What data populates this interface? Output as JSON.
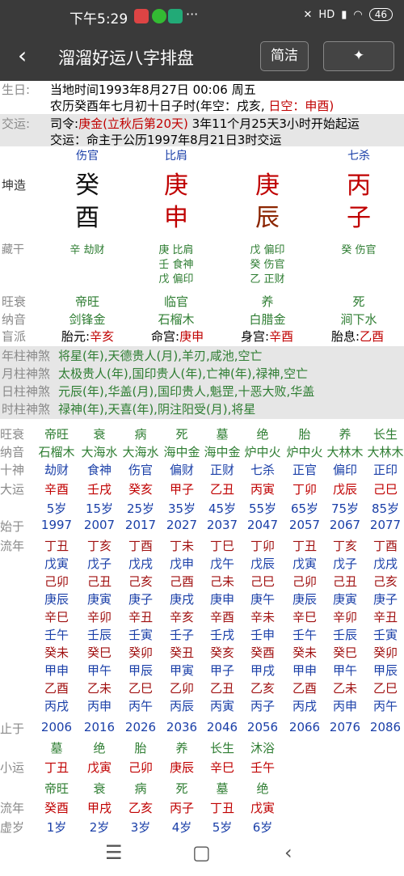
{
  "status": {
    "time": "下午5:29",
    "dots": "···",
    "right": "HD",
    "battery": "46"
  },
  "app": {
    "title": "溜溜好运八字排盘",
    "back": "‹",
    "btn_simple": "简洁",
    "btn_magic": "✦"
  },
  "info": {
    "sheng_label": "生日:",
    "sheng_line1": "当地时间1993年8月27日 00:06 周五",
    "sheng_line2a": "农历癸酉年七月初十日子时(年空：戌亥,",
    "sheng_line2b": " 日空：申酉)",
    "jiao_label": "交运:",
    "siling_a": "司令:",
    "siling_b": "庚金(立秋后第20天)",
    "siling_c": " 3年11个月25天3小时开始起运",
    "jiao_line2": "交运：命主于公历1997年8月21日3时交运"
  },
  "pillars": {
    "label": "坤造",
    "gods": [
      "伤官",
      "比肩",
      "",
      "七杀"
    ],
    "stems": [
      "癸",
      "庚",
      "庚",
      "丙"
    ],
    "branches": [
      "酉",
      "申",
      "辰",
      "子"
    ]
  },
  "canggan": {
    "label": "藏干",
    "cols": [
      [
        "辛 劫财"
      ],
      [
        "庚 比肩",
        "壬 食神",
        "戊 偏印"
      ],
      [
        "戊 偏印",
        "癸 伤官",
        "乙 正财"
      ],
      [
        "癸 伤官"
      ]
    ]
  },
  "wangshuai": {
    "label": "旺衰",
    "vals": [
      "帝旺",
      "临官",
      "养",
      "死"
    ]
  },
  "nayin": {
    "label": "纳音",
    "vals": [
      "剑锋金",
      "石榴木",
      "白腊金",
      "涧下水"
    ]
  },
  "mangpai": {
    "label": "盲派",
    "vals": [
      "胎元:",
      "辛亥",
      "命宫:",
      "庚申",
      "身宫:",
      "辛酉",
      "胎息:",
      "乙酉"
    ]
  },
  "shensha": [
    {
      "label": "年柱神煞",
      "text": "将星(年),天德贵人(月),羊刃,咸池,空亡"
    },
    {
      "label": "月柱神煞",
      "text": "太极贵人(年),国印贵人(年),亡神(年),禄神,空亡"
    },
    {
      "label": "日柱神煞",
      "text": "元辰(年),华盖(月),国印贵人,魁罡,十恶大败,华盖"
    },
    {
      "label": "时柱神煞",
      "text": "禄神(年),天喜(年),阴注阳受(月),将星"
    }
  ],
  "dayun": {
    "ws_label": "旺衰",
    "ws": [
      "帝旺",
      "衰",
      "病",
      "死",
      "墓",
      "绝",
      "胎",
      "养",
      "长生"
    ],
    "ny_label": "纳音",
    "ny": [
      "石榴木",
      "大海水",
      "大海水",
      "海中金",
      "海中金",
      "炉中火",
      "炉中火",
      "大林木",
      "大林木"
    ],
    "ss_label": "十神",
    "ss": [
      "劫财",
      "食神",
      "伤官",
      "偏财",
      "正财",
      "七杀",
      "正官",
      "偏印",
      "正印"
    ],
    "dy_label": "大运",
    "dy": [
      "辛酉",
      "壬戌",
      "癸亥",
      "甲子",
      "乙丑",
      "丙寅",
      "丁卯",
      "戊辰",
      "己巳"
    ],
    "age": [
      "5岁",
      "15岁",
      "25岁",
      "35岁",
      "45岁",
      "55岁",
      "65岁",
      "75岁",
      "85岁"
    ],
    "start_label": "始于",
    "start": [
      "1997",
      "2007",
      "2017",
      "2027",
      "2037",
      "2047",
      "2057",
      "2067",
      "2077"
    ],
    "ln_label": "流年",
    "liunian": [
      [
        "丁丑",
        "丁亥",
        "丁酉",
        "丁未",
        "丁巳",
        "丁卯",
        "丁丑",
        "丁亥",
        "丁酉"
      ],
      [
        "戊寅",
        "戊子",
        "戊戌",
        "戊申",
        "戊午",
        "戊辰",
        "戊寅",
        "戊子",
        "戊戌"
      ],
      [
        "己卯",
        "己丑",
        "己亥",
        "己酉",
        "己未",
        "己巳",
        "己卯",
        "己丑",
        "己亥"
      ],
      [
        "庚辰",
        "庚寅",
        "庚子",
        "庚戌",
        "庚申",
        "庚午",
        "庚辰",
        "庚寅",
        "庚子"
      ],
      [
        "辛巳",
        "辛卯",
        "辛丑",
        "辛亥",
        "辛酉",
        "辛未",
        "辛巳",
        "辛卯",
        "辛丑"
      ],
      [
        "壬午",
        "壬辰",
        "壬寅",
        "壬子",
        "壬戌",
        "壬申",
        "壬午",
        "壬辰",
        "壬寅"
      ],
      [
        "癸未",
        "癸巳",
        "癸卯",
        "癸丑",
        "癸亥",
        "癸酉",
        "癸未",
        "癸巳",
        "癸卯"
      ],
      [
        "甲申",
        "甲午",
        "甲辰",
        "甲寅",
        "甲子",
        "甲戌",
        "甲申",
        "甲午",
        "甲辰"
      ],
      [
        "乙酉",
        "乙未",
        "乙巳",
        "乙卯",
        "乙丑",
        "乙亥",
        "乙酉",
        "乙未",
        "乙巳"
      ],
      [
        "丙戌",
        "丙申",
        "丙午",
        "丙辰",
        "丙寅",
        "丙子",
        "丙戌",
        "丙申",
        "丙午"
      ]
    ],
    "end_label": "止于",
    "end": [
      "2006",
      "2016",
      "2026",
      "2036",
      "2046",
      "2056",
      "2066",
      "2076",
      "2086"
    ]
  },
  "xiaoyun": {
    "ws": [
      "墓",
      "绝",
      "胎",
      "养",
      "长生",
      "沐浴"
    ],
    "label": "小运",
    "vals": [
      "丁丑",
      "戊寅",
      "己卯",
      "庚辰",
      "辛巳",
      "壬午"
    ],
    "ws2": [
      "帝旺",
      "衰",
      "病",
      "死",
      "墓",
      "绝"
    ],
    "ln_label": "流年",
    "ln": [
      "癸酉",
      "甲戌",
      "乙亥",
      "丙子",
      "丁丑",
      "戊寅"
    ],
    "age_label": "虚岁",
    "ages": [
      "1岁",
      "2岁",
      "3岁",
      "4岁",
      "5岁",
      "6岁"
    ]
  },
  "nav": {
    "menu": "☰",
    "home": "▢",
    "back": "‹"
  }
}
